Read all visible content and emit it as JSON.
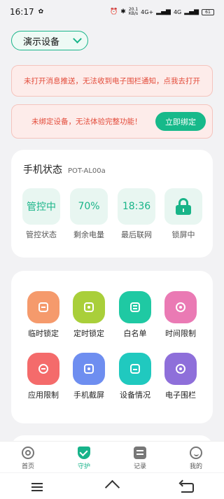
{
  "status_bar": {
    "time": "16:17",
    "network_speed_value": "20.1",
    "network_speed_unit": "KB/s",
    "signal1": "4G+",
    "signal2": "4G",
    "battery": "61"
  },
  "device_selector": {
    "label": "演示设备"
  },
  "notices": {
    "push": "未打开消息推送，无法收到电子围栏通知，点我去打开",
    "unbound": "未绑定设备，无法体验完整功能！",
    "bind_button": "立即绑定"
  },
  "phone_status": {
    "title": "手机状态",
    "model": "POT-AL00a",
    "items": [
      {
        "value": "管控中",
        "label": "管控状态"
      },
      {
        "value": "70%",
        "label": "剩余电量"
      },
      {
        "value": "18:36",
        "label": "最后联网"
      },
      {
        "value": "",
        "label": "锁屏中",
        "icon": "lock-icon"
      }
    ]
  },
  "functions": [
    {
      "label": "临时锁定",
      "color": "#f59a6c",
      "icon": "temp-lock-icon"
    },
    {
      "label": "定时锁定",
      "color": "#a9cf3a",
      "icon": "timer-lock-icon"
    },
    {
      "label": "白名单",
      "color": "#1fc9a3",
      "icon": "whitelist-icon"
    },
    {
      "label": "时间限制",
      "color": "#ea7ab4",
      "icon": "time-limit-icon"
    },
    {
      "label": "应用限制",
      "color": "#f46b6b",
      "icon": "app-limit-icon"
    },
    {
      "label": "手机截屏",
      "color": "#6e8ef0",
      "icon": "screenshot-icon"
    },
    {
      "label": "设备情况",
      "color": "#20c9bf",
      "icon": "device-info-icon"
    },
    {
      "label": "电子围栏",
      "color": "#8e6fda",
      "icon": "geofence-icon"
    }
  ],
  "bottom_nav": [
    {
      "label": "首页",
      "active": false
    },
    {
      "label": "守护",
      "active": true
    },
    {
      "label": "记录",
      "active": false
    },
    {
      "label": "我的",
      "active": false
    }
  ],
  "colors": {
    "accent": "#17b38a",
    "notice_text": "#e34b3a",
    "notice_bg": "#fdecea"
  }
}
